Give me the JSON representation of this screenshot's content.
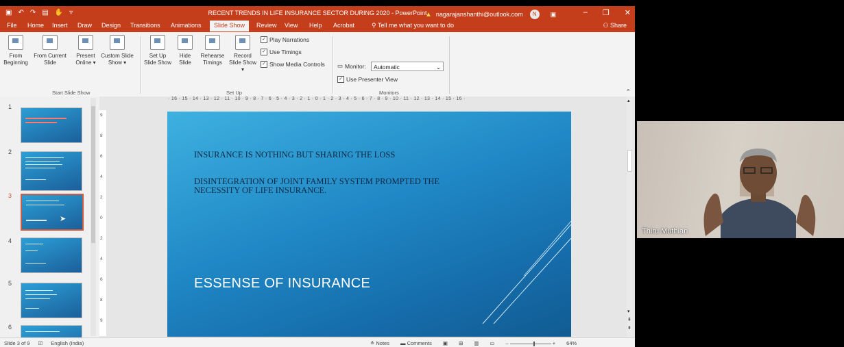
{
  "window": {
    "title": "RECENT TRENDS IN LIFE INSURANCE SECTOR DURING 2020  -  PowerPoint",
    "account_email": "nagarajanshanthi@outlook.com",
    "account_initial": "N"
  },
  "tabs": [
    "File",
    "Home",
    "Insert",
    "Draw",
    "Design",
    "Transitions",
    "Animations",
    "Slide Show",
    "Review",
    "View",
    "Help",
    "Acrobat"
  ],
  "tell_me": "Tell me what you want to do",
  "share_label": "Share",
  "ribbon": {
    "start": {
      "from_beginning": "From Beginning",
      "from_current": "From Current Slide",
      "present_online": "Present Online ▾",
      "custom_show": "Custom Slide Show ▾",
      "group": "Start Slide Show"
    },
    "setup": {
      "set_up": "Set Up Slide Show",
      "hide": "Hide Slide",
      "rehearse": "Rehearse Timings",
      "record": "Record Slide Show ▾",
      "play_narrations": "Play Narrations",
      "use_timings": "Use Timings",
      "show_media": "Show Media Controls",
      "group": "Set Up"
    },
    "monitors": {
      "monitor_label": "Monitor:",
      "monitor_value": "Automatic",
      "presenter_view": "Use Presenter View",
      "group": "Monitors"
    }
  },
  "thumbnails": [
    "1",
    "2",
    "3",
    "4",
    "5",
    "6"
  ],
  "ruler": "· 16 · 15 · 14 · 13 · 12 · 11 · 10 · 9 · 8 · 7 · 6 · 5 · 4 · 3 · 2 · 1 · 0 · 1 · 2 · 3 · 4 · 5 · 6 · 7 · 8 · 9 · 10 · 11 · 12 · 13 · 14 · 15 · 16 ·",
  "slide": {
    "line1": "INSURANCE IS NOTHING BUT SHARING THE LOSS",
    "line2": "DISINTEGRATION OF JOINT FAMILY SYSTEM PROMPTED THE NECESSITY OF LIFE INSURANCE.",
    "heading": "ESSENSE OF INSURANCE"
  },
  "status": {
    "slide_info": "Slide 3 of 9",
    "language": "English (India)",
    "notes": "Notes",
    "comments": "Comments",
    "zoom": "64%"
  },
  "video": {
    "participant_name": "Thiru Muthian"
  }
}
